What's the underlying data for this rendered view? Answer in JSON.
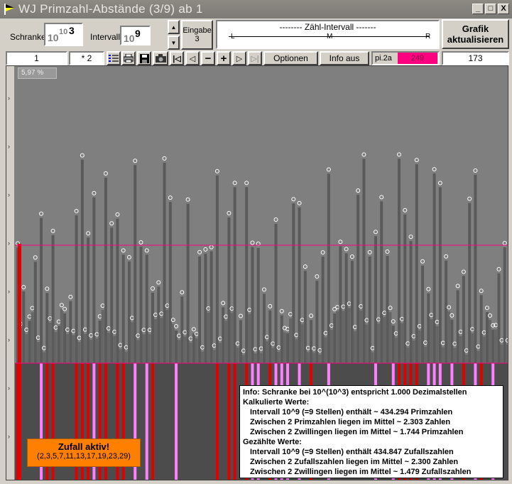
{
  "window": {
    "title": "WJ Primzahl-Abstände (3/9) ab 1",
    "controls": [
      "_",
      "□",
      "X"
    ]
  },
  "schranke": {
    "label": "Schranke",
    "base": "10",
    "mid": "10",
    "exp": "3"
  },
  "intervall": {
    "label": "Intervall",
    "base": "10",
    "exp": "9"
  },
  "eingabe": {
    "label": "Eingabe",
    "value": "3"
  },
  "zaehl": {
    "title": "-------- Zähl-Intervall -------",
    "l": "L",
    "m": "M",
    "r": "R"
  },
  "grafik_button": {
    "line1": "Grafik",
    "line2": "aktualisieren"
  },
  "row2": {
    "start_value": "1",
    "multiplier": "* 2",
    "optionen": "Optionen",
    "info_aus": "Info aus",
    "pi_label": "pi.2a",
    "pi_value": "249",
    "count": "173"
  },
  "plot": {
    "percent_label": "5,97 %"
  },
  "info": {
    "l1": "Info:  Schranke bei 10^(10^3) entspricht 1.000 Dezimalstellen",
    "l2": "Kalkulierte Werte:",
    "l3": "Intervall 10^9 (=9 Stellen) enthält ~ 434.294 Primzahlen",
    "l4": "Zwischen 2 Primzahlen liegen im Mittel ~ 2.303 Zahlen",
    "l5": "Zwischen 2 Zwillingen liegen im Mittel ~ 1.744 Primzahlen",
    "l6": "Gezählte Werte:",
    "l7": "Intervall 10^9 (=9 Stellen) enthält 434.847 Zufallszahlen",
    "l8": "Zwischen 2 Zufallszahlen liegen im Mittel ~ 2.300 Zahlen",
    "l9": "Zwischen 2 Zwillingen liegen im Mittel ~ 1.479 Zufallszahlen"
  },
  "zufall": {
    "title": "Zufall aktiv!",
    "primes": "(2,3,5,7,11,13,17,19,23,29)"
  },
  "colors": {
    "accent_pink": "#ff0080",
    "bar_red": "#e00000",
    "bar_pink": "#ff80ff",
    "bar_dark": "#4c4c4c",
    "orange": "#ff7f00"
  }
}
